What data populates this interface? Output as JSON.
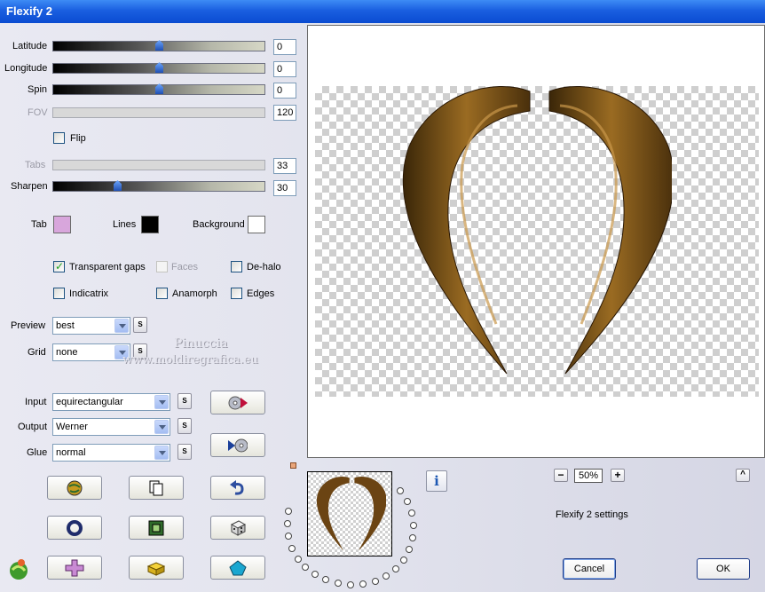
{
  "window": {
    "title": "Flexify 2"
  },
  "sliders": [
    {
      "label": "Latitude",
      "value": "0",
      "disabled": false,
      "level": 0.5
    },
    {
      "label": "Longitude",
      "value": "0",
      "disabled": false,
      "level": 0.5
    },
    {
      "label": "Spin",
      "value": "0",
      "disabled": false,
      "level": 0.5
    },
    {
      "label": "FOV",
      "value": "120",
      "disabled": true
    },
    {
      "label": "Tabs",
      "value": "33",
      "disabled": true
    },
    {
      "label": "Sharpen",
      "value": "30",
      "disabled": false,
      "level": 0.3
    }
  ],
  "flip": {
    "label": "Flip",
    "checked": false
  },
  "colors": {
    "tab_label": "Tab",
    "tab_color": "#d8a6dc",
    "lines_label": "Lines",
    "lines_color": "#000000",
    "background_label": "Background",
    "background_color": "#ffffff"
  },
  "options": {
    "transparent_gaps": {
      "label": "Transparent gaps",
      "checked": true
    },
    "faces": {
      "label": "Faces",
      "checked": false,
      "disabled": true
    },
    "de_halo": {
      "label": "De-halo",
      "checked": false
    },
    "indicatrix": {
      "label": "Indicatrix",
      "checked": false
    },
    "anamorph": {
      "label": "Anamorph",
      "checked": false
    },
    "edges": {
      "label": "Edges",
      "checked": false
    }
  },
  "dropdowns": {
    "preview": {
      "label": "Preview",
      "value": "best"
    },
    "grid": {
      "label": "Grid",
      "value": "none"
    },
    "input": {
      "label": "Input",
      "value": "equirectangular"
    },
    "output": {
      "label": "Output",
      "value": "Werner"
    },
    "glue": {
      "label": "Glue",
      "value": "normal"
    }
  },
  "small_button_label": "S",
  "watermark": {
    "line1": "Pinuccia",
    "line2": "www.moldiregrafica.eu"
  },
  "zoom": {
    "minus": "−",
    "value": "50%",
    "plus": "+"
  },
  "status_text": "Flexify 2 settings",
  "collapse_button": "^",
  "buttons": {
    "cancel": "Cancel",
    "ok": "OK"
  },
  "accent_colors": {
    "title_bar": "#0a4bd1",
    "brown": "#6b4413"
  }
}
